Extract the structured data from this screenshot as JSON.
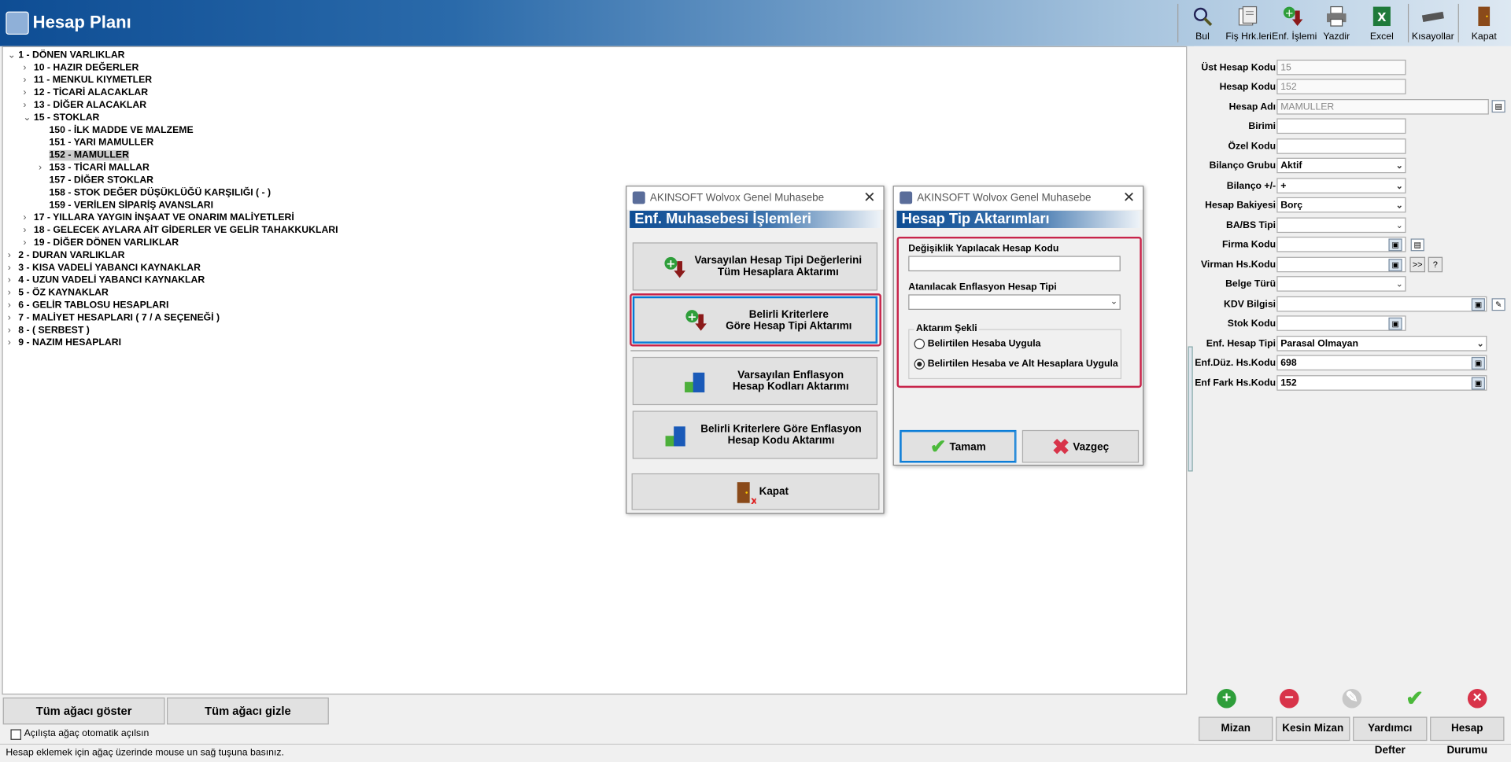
{
  "window": {
    "title": "Hesap Planı"
  },
  "toolbar": {
    "find": "Bul",
    "fis": "Fiş Hrk.leri",
    "enf": "Enf. İşlemi",
    "print": "Yazdir",
    "excel": "Excel",
    "shortcuts": "Kısayollar",
    "close": "Kapat"
  },
  "tree": [
    {
      "text": "1 - DÖNEN VARLIKLAR",
      "exp": "v"
    },
    {
      "text": "10 - HAZIR DEĞERLER",
      "exp": ">"
    },
    {
      "text": "11 - MENKUL KIYMETLER",
      "exp": ">"
    },
    {
      "text": "12 - TİCARİ ALACAKLAR",
      "exp": ">"
    },
    {
      "text": "13 - DİĞER ALACAKLAR",
      "exp": ">"
    },
    {
      "text": "15 - STOKLAR",
      "exp": "v"
    },
    {
      "text": "150 - İLK MADDE VE MALZEME",
      "exp": ""
    },
    {
      "text": "151 - YARI MAMULLER",
      "exp": ""
    },
    {
      "text": "152 - MAMULLER",
      "exp": ""
    },
    {
      "text": "153 - TİCARİ MALLAR",
      "exp": ">"
    },
    {
      "text": "157 - DİĞER STOKLAR",
      "exp": ""
    },
    {
      "text": "158 - STOK DEĞER DÜŞÜKLÜĞÜ KARŞILIĞI ( - )",
      "exp": ""
    },
    {
      "text": "159 - VERİLEN SİPARİŞ AVANSLARI",
      "exp": ""
    },
    {
      "text": "17 - YILLARA YAYGIN İNŞAAT VE ONARIM MALİYETLERİ",
      "exp": ">"
    },
    {
      "text": "18 - GELECEK AYLARA AİT GİDERLER VE GELİR TAHAKKUKLARI",
      "exp": ">"
    },
    {
      "text": "19 - DİĞER DÖNEN VARLIKLAR",
      "exp": ">"
    },
    {
      "text": "2 - DURAN VARLIKLAR",
      "exp": ">"
    },
    {
      "text": "3 - KISA VADELİ YABANCI KAYNAKLAR",
      "exp": ">"
    },
    {
      "text": "4 - UZUN VADELİ YABANCI KAYNAKLAR",
      "exp": ">"
    },
    {
      "text": "5 - ÖZ KAYNAKLAR",
      "exp": ">"
    },
    {
      "text": "6 - GELİR TABLOSU HESAPLARI",
      "exp": ">"
    },
    {
      "text": "7 - MALİYET HESAPLARI ( 7 / A  SEÇENEĞİ )",
      "exp": ">"
    },
    {
      "text": "8 - ( SERBEST )",
      "exp": ">"
    },
    {
      "text": "9 - NAZIM HESAPLARI",
      "exp": ">"
    }
  ],
  "tree_buttons": {
    "show": "Tüm ağacı göster",
    "hide": "Tüm ağacı gizle"
  },
  "auto_open_label": "Açılışta ağaç otomatik açılsın",
  "status": "Hesap eklemek için ağaç üzerinde mouse un sağ tuşuna basınız.",
  "form": {
    "ust_kod_label": "Üst Hesap Kodu",
    "ust_kod": "15",
    "kod_label": "Hesap Kodu",
    "kod": "152",
    "ad_label": "Hesap Adı",
    "ad": "MAMULLER",
    "birim_label": "Birimi",
    "birim": "",
    "ozel_label": "Özel Kodu",
    "ozel": "",
    "bilanco_label": "Bilanço Grubu",
    "bilanco": "Aktif",
    "bilanco_pm_label": "Bilanço +/-",
    "bilanco_pm": "+",
    "bakiye_label": "Hesap Bakiyesi",
    "bakiye": "Borç",
    "babs_label": "BA/BS Tipi",
    "babs": "",
    "firma_label": "Firma Kodu",
    "firma": "",
    "virman_label": "Virman Hs.Kodu",
    "virman": "",
    "virman_btn": ">>",
    "help_btn": "?",
    "belge_label": "Belge Türü",
    "belge": "",
    "kdv_label": "KDV Bilgisi",
    "kdv": "",
    "stok_label": "Stok Kodu",
    "stok": "",
    "enf_tip_label": "Enf. Hesap Tipi",
    "enf_tip": "Parasal Olmayan",
    "enf_duz_label": "Enf.Düz. Hs.Kodu",
    "enf_duz": "698",
    "enf_fark_label": "Enf Fark Hs.Kodu",
    "enf_fark": "152"
  },
  "bottom_buttons": {
    "mizan": "Mizan",
    "kesin": "Kesin Mizan",
    "yardimci": "Yardımcı Defter",
    "durum": "Hesap Durumu"
  },
  "dialog1": {
    "caption": "AKINSOFT Wolvox Genel Muhasebe",
    "header": "Enf. Muhasebesi İşlemleri",
    "btn1_l1": "Varsayılan Hesap Tipi Değerlerini",
    "btn1_l2": "Tüm Hesaplara Aktarımı",
    "btn2_l1": "Belirli Kriterlere",
    "btn2_l2": "Göre Hesap Tipi Aktarımı",
    "btn3_l1": "Varsayılan Enflasyon",
    "btn3_l2": "Hesap Kodları Aktarımı",
    "btn4_l1": "Belirli Kriterlere Göre Enflasyon",
    "btn4_l2": "Hesap Kodu Aktarımı",
    "close": "Kapat"
  },
  "dialog2": {
    "caption": "AKINSOFT Wolvox Genel Muhasebe",
    "header": "Hesap Tip Aktarımları",
    "field1_label": "Değişiklik Yapılacak Hesap Kodu",
    "field1_value": "",
    "field2_label": "Atanılacak Enflasyon Hesap Tipi",
    "field2_value": "",
    "group_label": "Aktarım Şekli",
    "radio1": "Belirtilen Hesaba Uygula",
    "radio2": "Belirtilen Hesaba ve Alt Hesaplara Uygula",
    "radio_selected": 2,
    "ok": "Tamam",
    "cancel": "Vazgeç"
  },
  "colors": {
    "accent": "#0e4d94",
    "highlight": "#c8244a",
    "add": "#2e9e3a",
    "remove": "#d8344a",
    "ok": "#4bb93a"
  }
}
